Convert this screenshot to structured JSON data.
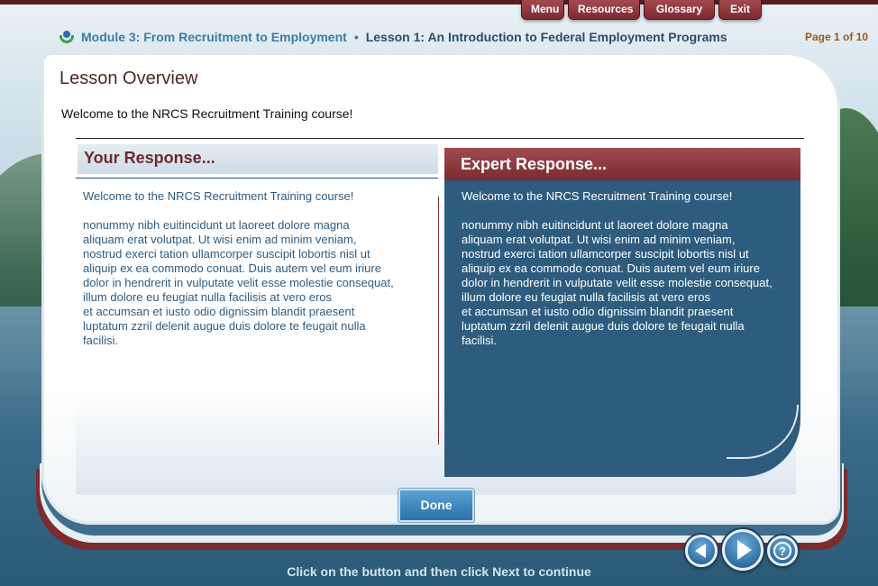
{
  "top_menu": {
    "menu": "Menu",
    "resources": "Resources",
    "glossary": "Glossary",
    "exit": "Exit"
  },
  "breadcrumb": {
    "module": "Module 3: From Recruitment to Employment",
    "separator": "•",
    "lesson": "Lesson 1: An Introduction to Federal Employment Programs"
  },
  "page_count": "Page 1 of 10",
  "lesson": {
    "title": "Lesson Overview",
    "welcome": "Welcome to the NRCS Recruitment Training course!"
  },
  "your_response": {
    "title": "Your Response...",
    "text": "Welcome to the NRCS Recruitment Training course!\n\nnonummy nibh euitincidunt ut laoreet dolore magna\naliquam erat volutpat. Ut wisi enim ad minim veniam,\nnostrud exerci tation ullamcorper suscipit lobortis nisl ut\naliquip ex ea commodo conuat. Duis autem vel eum iriure\ndolor in hendrerit in vulputate velit esse molestie consequat,\nillum dolore eu feugiat nulla facilisis at vero eros\net accumsan et iusto odio dignissim blandit praesent\nluptatum zzril delenit augue duis dolore te feugait nulla\nfacilisi."
  },
  "expert_response": {
    "title": "Expert Response...",
    "text": "Welcome to the NRCS Recruitment Training course!\n\nnonummy nibh euitincidunt ut laoreet dolore magna\naliquam erat volutpat. Ut wisi enim ad minim veniam,\nnostrud exerci tation ullamcorper suscipit lobortis nisl ut\naliquip ex ea commodo conuat. Duis autem vel eum iriure\ndolor in hendrerit in vulputate velit esse molestie consequat,\nillum dolore eu feugiat nulla facilisis at vero eros\net accumsan et iusto odio dignissim blandit praesent\nluptatum zzril delenit augue duis dolore te feugait nulla\nfacilisi."
  },
  "done_button": "Done",
  "footer_instruction": "Click on the button and then click Next to continue",
  "nav": {
    "prev_icon": "arrow-left-icon",
    "next_icon": "arrow-right-icon",
    "help_label": "?"
  },
  "colors": {
    "maroon": "#7a2c31",
    "expert_blue": "#2e5c7f",
    "link_blue": "#3d7ca8",
    "page_count_orange": "#9a5a1a"
  }
}
